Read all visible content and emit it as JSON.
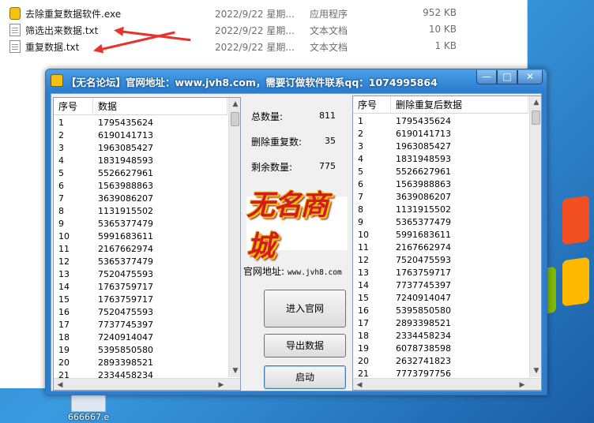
{
  "explorer": {
    "files": [
      {
        "name": "去除重复数据软件.exe",
        "date": "2022/9/22 星期...",
        "type": "应用程序",
        "size": "952 KB",
        "icon": "exe-icon"
      },
      {
        "name": "筛选出来数据.txt",
        "date": "2022/9/22 星期...",
        "type": "文本文档",
        "size": "10 KB",
        "icon": "text-file-icon"
      },
      {
        "name": "重复数据.txt",
        "date": "2022/9/22 星期...",
        "type": "文本文档",
        "size": "1 KB",
        "icon": "text-file-icon"
      }
    ]
  },
  "desktop": {
    "icon_label": "666667.e"
  },
  "window": {
    "title": "【无名论坛】官网地址：www.jvh8.com，需要订做软件联系qq：1074995864",
    "controls": {
      "minimize": "—",
      "maximize": "□",
      "close": "✕"
    }
  },
  "left_list": {
    "headers": [
      "序号",
      "数据"
    ],
    "rows": [
      [
        "1",
        "1795435624"
      ],
      [
        "2",
        "6190141713"
      ],
      [
        "3",
        "1963085427"
      ],
      [
        "4",
        "1831948593"
      ],
      [
        "5",
        "5526627961"
      ],
      [
        "6",
        "1563988863"
      ],
      [
        "7",
        "3639086207"
      ],
      [
        "8",
        "1131915502"
      ],
      [
        "9",
        "5365377479"
      ],
      [
        "10",
        "5991683611"
      ],
      [
        "11",
        "2167662974"
      ],
      [
        "12",
        "5365377479"
      ],
      [
        "13",
        "7520475593"
      ],
      [
        "14",
        "1763759717"
      ],
      [
        "15",
        "1763759717"
      ],
      [
        "16",
        "7520475593"
      ],
      [
        "17",
        "7737745397"
      ],
      [
        "18",
        "7240914047"
      ],
      [
        "19",
        "5395850580"
      ],
      [
        "20",
        "2893398521"
      ],
      [
        "21",
        "2334458234"
      ]
    ]
  },
  "stats": {
    "total_label": "总数量:",
    "total_value": "811",
    "removed_label": "删除重复数:",
    "removed_value": "35",
    "remaining_label": "剩余数量:",
    "remaining_value": "775"
  },
  "logo": {
    "text": "无名商城"
  },
  "site": {
    "label": "官网地址:",
    "value": "www.jvh8.com"
  },
  "buttons": {
    "enter_site": "进入官网",
    "export": "导出数据",
    "start": "启动"
  },
  "right_list": {
    "headers": [
      "序号",
      "删除重复后数据"
    ],
    "rows": [
      [
        "1",
        "1795435624"
      ],
      [
        "2",
        "6190141713"
      ],
      [
        "3",
        "1963085427"
      ],
      [
        "4",
        "1831948593"
      ],
      [
        "5",
        "5526627961"
      ],
      [
        "6",
        "1563988863"
      ],
      [
        "7",
        "3639086207"
      ],
      [
        "8",
        "1131915502"
      ],
      [
        "9",
        "5365377479"
      ],
      [
        "10",
        "5991683611"
      ],
      [
        "11",
        "2167662974"
      ],
      [
        "12",
        "7520475593"
      ],
      [
        "13",
        "1763759717"
      ],
      [
        "14",
        "7737745397"
      ],
      [
        "15",
        "7240914047"
      ],
      [
        "16",
        "5395850580"
      ],
      [
        "17",
        "2893398521"
      ],
      [
        "18",
        "2334458234"
      ],
      [
        "19",
        "6078738598"
      ],
      [
        "20",
        "2632741823"
      ],
      [
        "21",
        "7773797756"
      ]
    ]
  }
}
